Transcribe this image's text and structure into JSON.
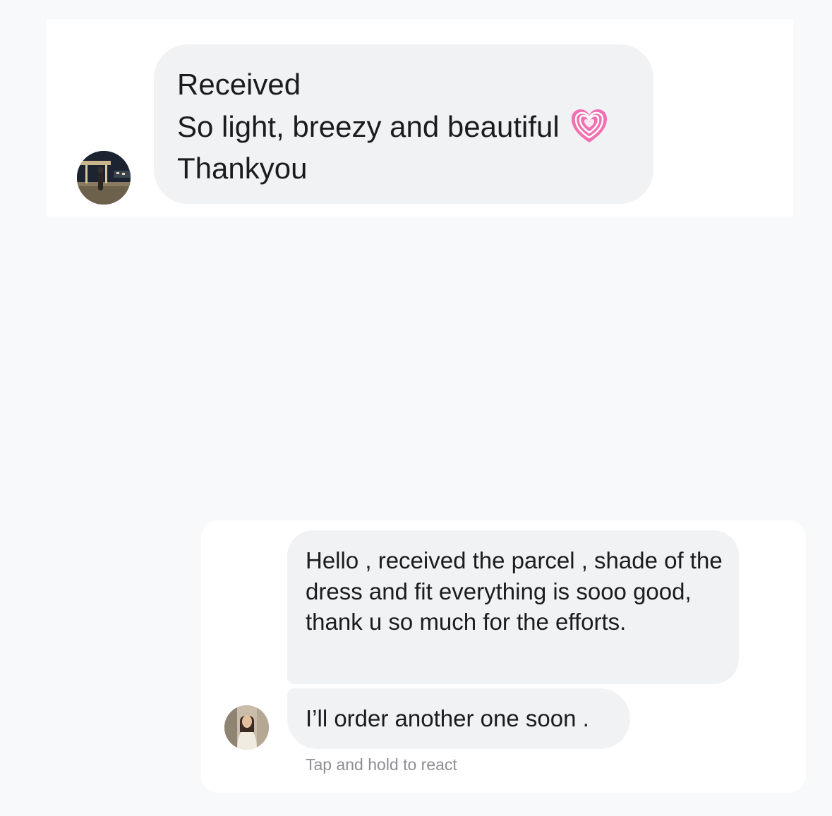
{
  "thread_1": {
    "message": {
      "lines": [
        "Received",
        "So light, breezy and beautiful",
        "Thankyou"
      ],
      "emoji": "growing-heart-icon"
    },
    "avatar": "user-avatar-night-photo"
  },
  "thread_2": {
    "messages": [
      "Hello , received the parcel , shade of the dress and fit everything is sooo good, thank u so much for the efforts.",
      "I’ll order another one soon ."
    ],
    "avatar": "user-avatar-portrait",
    "react_hint": "Tap and hold to react"
  },
  "colors": {
    "page_background": "#f8f9fa",
    "card_background": "#ffffff",
    "bubble_background": "#f1f2f4",
    "text": "#1c1c1e",
    "hint_text": "#8e8e93",
    "heart": "#f26fb1"
  }
}
